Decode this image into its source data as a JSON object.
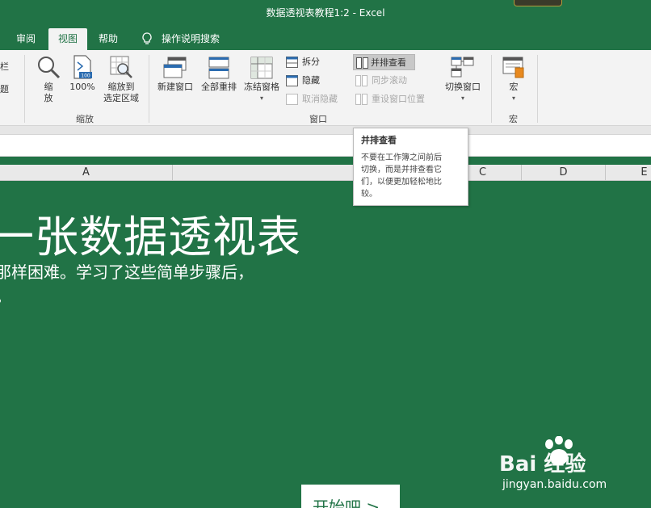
{
  "window": {
    "title": "数据透视表教程1:2  -  Excel"
  },
  "tabs": [
    {
      "label": "审阅"
    },
    {
      "label": "视图",
      "active": true
    },
    {
      "label": "帮助"
    }
  ],
  "search": {
    "label": "操作说明搜索"
  },
  "ribbon": {
    "edge_label_1": "栏",
    "edge_label_2": "题",
    "zoom_group": {
      "label": "缩放",
      "zoom_line1": "缩",
      "zoom_line2": "放",
      "pct_label": "100%",
      "pct_icon_text": "100",
      "sel_line1": "缩放到",
      "sel_line2": "选定区域"
    },
    "window_group": {
      "label": "窗口",
      "new_window": "新建窗口",
      "arrange_all": "全部重排",
      "freeze_panes": "冻结窗格",
      "split": "拆分",
      "hide": "隐藏",
      "unhide": "取消隐藏",
      "side_by_side": "并排查看",
      "sync_scroll": "同步滚动",
      "reset_position": "重设窗口位置",
      "switch_windows": "切换窗口"
    },
    "macro_group": {
      "label": "宏",
      "macros": "宏"
    }
  },
  "columns": [
    "A",
    "C",
    "D",
    "E"
  ],
  "sheet": {
    "headline": "一张数据透视表",
    "subtitle_line1": "那样困难。学习了这些简单步骤后，",
    "subtitle_line2": "。",
    "start_button": "开始吧 >"
  },
  "tooltip": {
    "title": "并排查看",
    "lines": [
      "不要在工作簿之间前后",
      "切换，而是并排查看它",
      "们，以便更加轻松地比",
      "较。"
    ]
  },
  "watermark": {
    "logo": "Bai  经验",
    "url": "jingyan.baidu.com"
  },
  "colors": {
    "excel_green": "#217346",
    "ribbon_bg": "#f3f3f3"
  }
}
